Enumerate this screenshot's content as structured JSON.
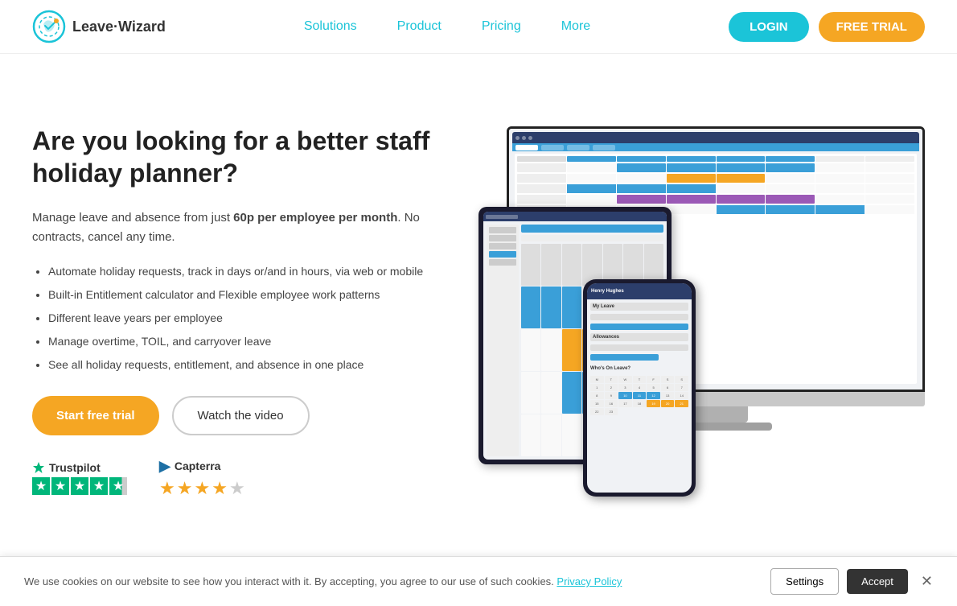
{
  "brand": {
    "name": "Leave·Wizard",
    "logo_alt": "Leave Wizard logo"
  },
  "nav": {
    "links": [
      {
        "id": "solutions",
        "label": "Solutions"
      },
      {
        "id": "product",
        "label": "Product"
      },
      {
        "id": "pricing",
        "label": "Pricing"
      },
      {
        "id": "more",
        "label": "More"
      }
    ],
    "login_label": "LOGIN",
    "free_trial_label": "FREE TRIAL"
  },
  "hero": {
    "title": "Are you looking for a better staff holiday planner?",
    "subtitle_prefix": "Manage leave and absence from just ",
    "subtitle_bold": "60p per employee per month",
    "subtitle_suffix": ". No contracts, cancel any time.",
    "features": [
      "Automate holiday requests, track in days or/and in hours, via web or mobile",
      "Built-in Entitlement calculator and Flexible employee work patterns",
      "Different leave years per employee",
      "Manage overtime, TOIL, and carryover leave",
      "See all holiday requests, entitlement, and absence in one place"
    ],
    "cta_primary": "Start free trial",
    "cta_secondary": "Watch the video"
  },
  "trust": {
    "trustpilot_label": "Trustpilot",
    "capterra_label": "Capterra"
  },
  "cookie": {
    "message": "We use cookies on our website to see how you interact with it. By accepting, you agree to our use of such cookies.",
    "policy_label": "Privacy Policy",
    "settings_label": "Settings",
    "accept_label": "Accept"
  },
  "colors": {
    "accent_teal": "#1bc4d8",
    "accent_orange": "#f5a623",
    "nav_link": "#1bc4d8",
    "dark_blue": "#2c3e6b"
  }
}
